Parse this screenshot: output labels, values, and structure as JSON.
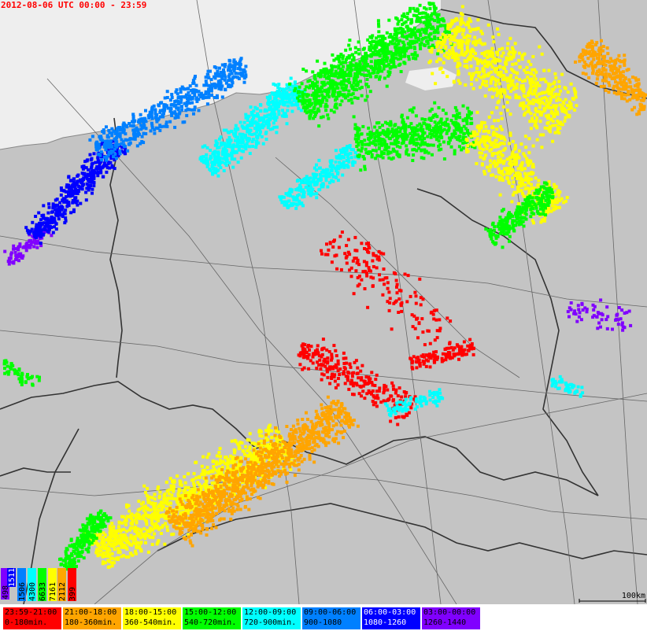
{
  "header": {
    "title": "2012-08-06 UTC 00:00 - 23:59"
  },
  "scale": {
    "label": "100km"
  },
  "counts": [
    {
      "value": "498",
      "color": "#8000ff"
    },
    {
      "value": "1511",
      "color": "#0000ff"
    },
    {
      "value": "1506",
      "color": "#0080ff"
    },
    {
      "value": "4300",
      "color": "#00ffff"
    },
    {
      "value": "6633",
      "color": "#00ff00"
    },
    {
      "value": "7161",
      "color": "#ffff00"
    },
    {
      "value": "2112",
      "color": "#ffa500"
    },
    {
      "value": "399",
      "color": "#ff0000"
    }
  ],
  "legend": [
    {
      "time": "23:59-21:00",
      "minutes": "0-180min.",
      "color": "#ff0000",
      "text_color": "#000000"
    },
    {
      "time": "21:00-18:00",
      "minutes": "180-360min.",
      "color": "#ffa500",
      "text_color": "#000000"
    },
    {
      "time": "18:00-15:00",
      "minutes": "360-540min.",
      "color": "#ffff00",
      "text_color": "#000000"
    },
    {
      "time": "15:00-12:00",
      "minutes": "540-720min.",
      "color": "#00ff00",
      "text_color": "#000000"
    },
    {
      "time": "12:00-09:00",
      "minutes": "720-900min.",
      "color": "#00ffff",
      "text_color": "#000000"
    },
    {
      "time": "09:00-06:00",
      "minutes": "900-1080",
      "color": "#0080ff",
      "text_color": "#000000"
    },
    {
      "time": "06:00-03:00",
      "minutes": "1080-1260",
      "color": "#0000ff",
      "text_color": "#ffffff"
    },
    {
      "time": "03:00-00:00",
      "minutes": "1260-1440",
      "color": "#8000ff",
      "text_color": "#000000"
    }
  ]
}
